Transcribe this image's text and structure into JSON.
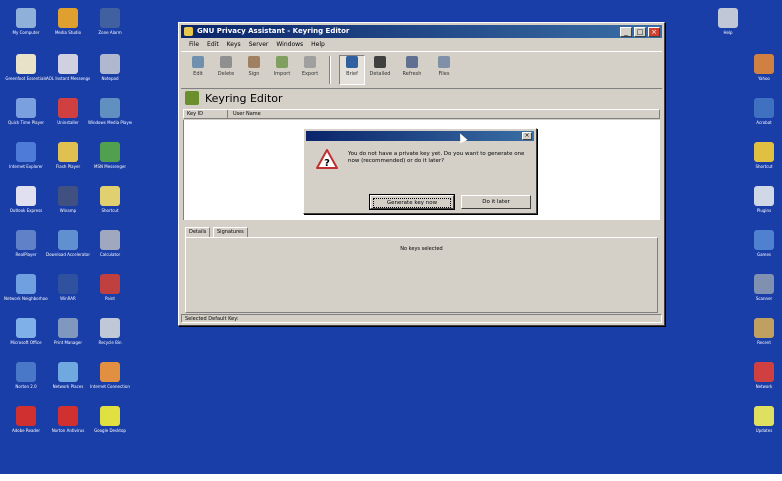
{
  "desktop": {
    "background_color": "#1a3ea8",
    "icons_left": [
      {
        "label": "My Computer",
        "icon": "computer-icon",
        "color": "#8fb0d8"
      },
      {
        "label": "Greenfoot Essentials",
        "icon": "star-icon",
        "color": "#e8e2c8"
      },
      {
        "label": "Quick Time Player",
        "icon": "quicktime-icon",
        "color": "#7aa0e0"
      },
      {
        "label": "Internet Explorer",
        "icon": "ie-icon",
        "color": "#4e7bd8"
      },
      {
        "label": "Outlook Express",
        "icon": "mail-icon",
        "color": "#e0e0f0"
      },
      {
        "label": "RealPlayer",
        "icon": "realplayer-icon",
        "color": "#6080c8"
      },
      {
        "label": "Network Neighborhood",
        "icon": "network-icon",
        "color": "#70a0e0"
      },
      {
        "label": "Microsoft Office",
        "icon": "office-icon",
        "color": "#7fb0e8"
      },
      {
        "label": "Norton 2.0",
        "icon": "norton-icon",
        "color": "#4a78c8"
      },
      {
        "label": "Adobe Reader",
        "icon": "pdf-icon",
        "color": "#d03030"
      },
      {
        "label": "Media Studio",
        "icon": "media-icon",
        "color": "#e0a030"
      },
      {
        "label": "AOL Instant Messenger",
        "icon": "aim-icon",
        "color": "#d0d0e0"
      },
      {
        "label": "Uninstaller",
        "icon": "uninstall-icon",
        "color": "#d04040"
      },
      {
        "label": "Flash Player",
        "icon": "flash-icon",
        "color": "#e0c050"
      },
      {
        "label": "Winamp",
        "icon": "winamp-icon",
        "color": "#405080"
      },
      {
        "label": "Download Accelerator",
        "icon": "download-icon",
        "color": "#6090d0"
      },
      {
        "label": "WinRAR",
        "icon": "winrar-icon",
        "color": "#3050a0"
      },
      {
        "label": "Print Manager",
        "icon": "printer-icon",
        "color": "#8098c0"
      },
      {
        "label": "Network Places",
        "icon": "globe-icon",
        "color": "#70a8e0"
      },
      {
        "label": "Norton Antivirus",
        "icon": "shield-icon",
        "color": "#d03030"
      },
      {
        "label": "Zone Alarm",
        "icon": "zone-icon",
        "color": "#4060a0"
      },
      {
        "label": "Notepad",
        "icon": "notepad-icon",
        "color": "#b0b8d0"
      },
      {
        "label": "Windows Media Player",
        "icon": "wmp-icon",
        "color": "#6090c0"
      },
      {
        "label": "MSN Messenger",
        "icon": "msn-icon",
        "color": "#50a050"
      },
      {
        "label": "Shortcut",
        "icon": "folder-icon",
        "color": "#e0d070"
      },
      {
        "label": "Calculator",
        "icon": "calc-icon",
        "color": "#a0a8c0"
      },
      {
        "label": "Paint",
        "icon": "paint-icon",
        "color": "#c04040"
      },
      {
        "label": "Recycle Bin",
        "icon": "recycle-icon",
        "color": "#c0c8d8"
      },
      {
        "label": "Internet Connection",
        "icon": "connection-icon",
        "color": "#e09040"
      },
      {
        "label": "Google Desktop",
        "icon": "google-icon",
        "color": "#e0e040"
      }
    ],
    "icons_right": [
      {
        "label": "Help",
        "icon": "help-icon",
        "color": "#c0c8d8"
      },
      {
        "label": "Yahoo",
        "icon": "yahoo-icon",
        "color": "#d08040"
      },
      {
        "label": "Acrobat",
        "icon": "acrobat-icon",
        "color": "#4070c0"
      },
      {
        "label": "Shortcut",
        "icon": "shortcut-icon",
        "color": "#e0c040"
      },
      {
        "label": "Plugins",
        "icon": "plugin-icon",
        "color": "#d0d8e8"
      },
      {
        "label": "Games",
        "icon": "games-icon",
        "color": "#5080d0"
      },
      {
        "label": "Scanner",
        "icon": "scanner-icon",
        "color": "#8090b0"
      },
      {
        "label": "Recent",
        "icon": "recent-icon",
        "color": "#c0a060"
      },
      {
        "label": "Network",
        "icon": "network2-icon",
        "color": "#d04040"
      },
      {
        "label": "Updates",
        "icon": "update-icon",
        "color": "#e0e060"
      }
    ]
  },
  "app_window": {
    "title": "GNU Privacy Assistant - Keyring Editor",
    "menu": [
      "File",
      "Edit",
      "Keys",
      "Server",
      "Windows",
      "Help"
    ],
    "toolbar": [
      {
        "label": "Edit",
        "icon": "edit-icon"
      },
      {
        "label": "Delete",
        "icon": "delete-icon"
      },
      {
        "label": "Sign",
        "icon": "sign-icon"
      },
      {
        "label": "Import",
        "icon": "import-icon"
      },
      {
        "label": "Export",
        "icon": "export-icon"
      },
      {
        "label": "Brief",
        "icon": "brief-icon",
        "pressed": true
      },
      {
        "label": "Detailed",
        "icon": "detailed-icon"
      },
      {
        "label": "Refresh",
        "icon": "refresh-icon"
      },
      {
        "label": "Files",
        "icon": "files-icon"
      }
    ],
    "editor_title": "Keyring Editor",
    "columns": [
      "Key ID",
      "User Name"
    ],
    "details_tabs": [
      "Details",
      "Signatures"
    ],
    "no_key_text": "No keys selected",
    "status_text": "Selected Default Key:"
  },
  "dialog": {
    "message": "You do not have a private key yet. Do you want to generate one now (recommended) or do it later?",
    "buttons": [
      "Generate key now",
      "Do it later"
    ]
  }
}
